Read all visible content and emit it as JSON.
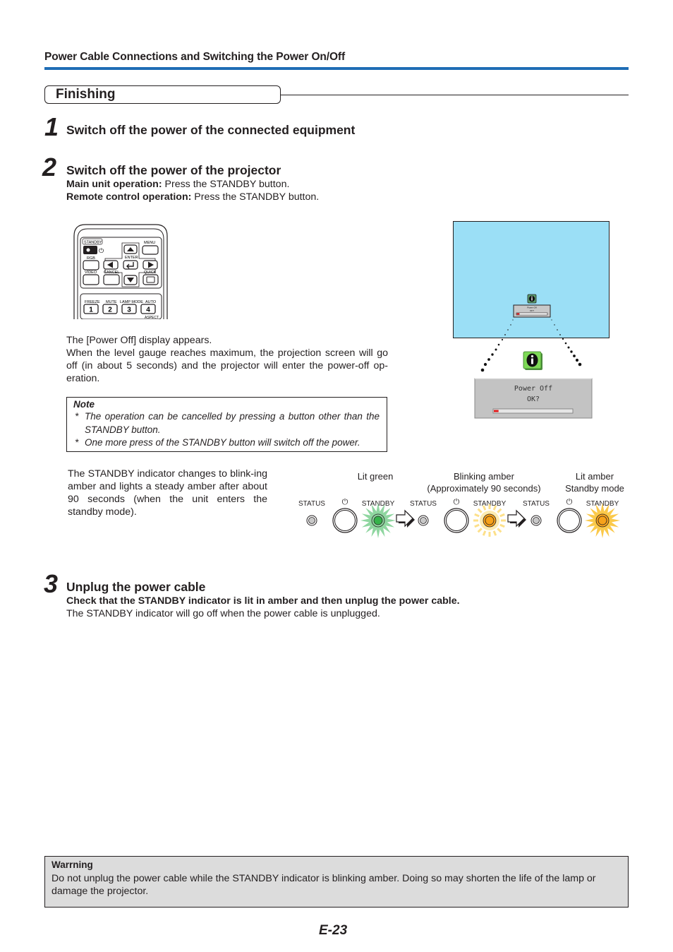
{
  "header": {
    "section_title": "Power Cable Connections and Switching the Power On/Off",
    "accent_color": "#1f6db5"
  },
  "subsection": {
    "title": "Finishing"
  },
  "steps": [
    {
      "number": "1",
      "title": "Switch off the power of the connected equipment"
    },
    {
      "number": "2",
      "title": "Switch off the power of the projector",
      "main_unit_label": "Main unit operation:",
      "main_unit_text": " Press the STANDBY button.",
      "remote_label": "Remote control operation:",
      "remote_text": " Press the STANDBY button.",
      "display_text_1": "The [Power Off] display appears.",
      "display_text_2": "When the level gauge reaches maximum, the projection screen will go off (in about 5 seconds) and the projector will enter the power-off op-eration.",
      "note": {
        "title": "Note",
        "items": [
          "The operation can be cancelled by pressing a button other than the STANDBY button.",
          "One more press of the STANDBY button will switch off the power."
        ]
      },
      "indicator_text": "The STANDBY indicator changes to blink-ing amber and lights a steady amber after about 90 seconds (when the unit enters the standby mode)."
    },
    {
      "number": "3",
      "title": "Unplug the power cable",
      "bold_text": "Check that the STANDBY indicator is lit in amber and then unplug the power cable.",
      "text": "The STANDBY indicator will go off when the power cable is unplugged."
    }
  ],
  "remote": {
    "labels": {
      "standby": "STANDBY",
      "menu": "MENU",
      "rgb": "RGB",
      "enter": "ENTER",
      "video": "VIDEO",
      "cancel": "CANCEL",
      "quick": "QUICK",
      "freeze": "FREEZE",
      "mute": "MUTE",
      "lamp_mode": "LAMP MODE",
      "auto": "AUTO",
      "aspect": "ASPECT"
    },
    "number_keys": [
      "1",
      "2",
      "3",
      "4"
    ]
  },
  "projection": {
    "screen_color": "#9bdff6",
    "dialog_line1": "Power Off",
    "dialog_line2": "OK?",
    "gauge_fraction": 0.06,
    "gauge_color": "#e0191b",
    "icon": "info-icon",
    "icon_color": "#7ed957"
  },
  "indicator_states": [
    {
      "caption_1": "Lit green",
      "caption_2": "",
      "status_label": "STATUS",
      "standby_label": "STANDBY",
      "color": "#35b24a",
      "glow": "#8fd6a0",
      "mode": "lit"
    },
    {
      "caption_1": "Blinking amber",
      "caption_2": "(Approximately 90 seconds)",
      "status_label": "STATUS",
      "standby_label": "STANDBY",
      "color": "#f7a21b",
      "glow": "#fde08a",
      "mode": "blink"
    },
    {
      "caption_1": "Lit amber",
      "caption_2": "Standby mode",
      "status_label": "STATUS",
      "standby_label": "STANDBY",
      "color": "#f7a21b",
      "glow": "#fbc94a",
      "mode": "lit"
    }
  ],
  "warning": {
    "title": "Warrning",
    "text": "Do not unplug the power cable while the STANDBY indicator is blinking amber. Doing so may shorten the life of the lamp or damage the projector."
  },
  "footer": {
    "page_number": "E-23"
  }
}
